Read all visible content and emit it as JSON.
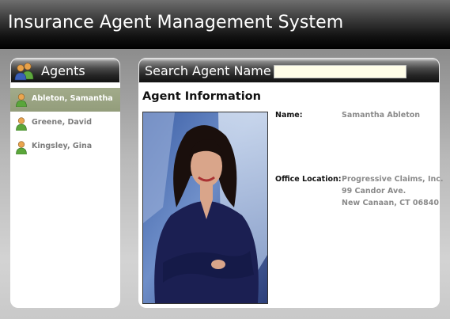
{
  "app": {
    "title": "Insurance Agent Management System"
  },
  "agents_panel": {
    "title": "Agents",
    "header_icon": "people-group-icon",
    "items": [
      {
        "label": "Ableton, Samantha",
        "icon": "person-icon",
        "selected": true
      },
      {
        "label": "Greene, David",
        "icon": "person-icon",
        "selected": false
      },
      {
        "label": "Kingsley, Gina",
        "icon": "person-icon",
        "selected": false
      }
    ]
  },
  "search": {
    "label": "Search Agent Name",
    "value": "",
    "placeholder": ""
  },
  "info": {
    "heading": "Agent Information",
    "photo_icon": "agent-photo",
    "name_label": "Name:",
    "name_value": "Samantha Ableton",
    "office_label": "Office Location:",
    "office_lines": [
      "Progressive Claims, Inc.",
      "99 Candor Ave.",
      "New Canaan, CT 06840"
    ]
  },
  "colors": {
    "selected_row": "#9ba484",
    "value_text": "#8a8a8a",
    "search_field": "#fffde8"
  }
}
